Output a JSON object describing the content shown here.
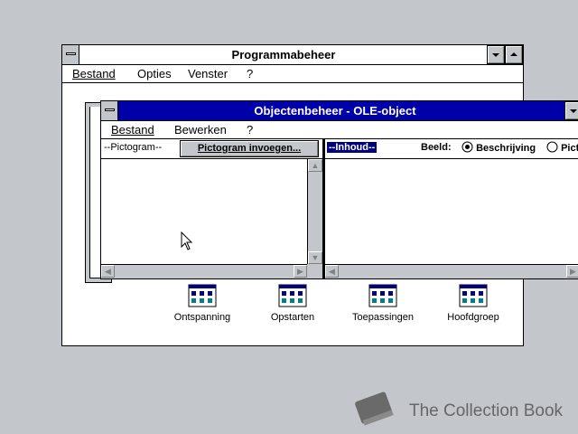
{
  "program_manager": {
    "title": "Programmabeheer",
    "menu": [
      "Bestand",
      "Opties",
      "Venster",
      "?"
    ],
    "groups": [
      "Ontspanning",
      "Opstarten",
      "Toepassingen",
      "Hoofdgroep"
    ]
  },
  "object_packager": {
    "title": "Objectenbeheer - OLE-object",
    "menu": [
      "Bestand",
      "Bewerken",
      "?"
    ],
    "left_label": "--Pictogram--",
    "insert_button": "Pictogram invoegen...",
    "right_label": "--Inhoud--",
    "view_label": "Beeld:",
    "radio_description": "Beschrijving",
    "radio_picture": "Pict",
    "selected_view": "Beschrijving"
  },
  "watermark": "The Collection Book"
}
